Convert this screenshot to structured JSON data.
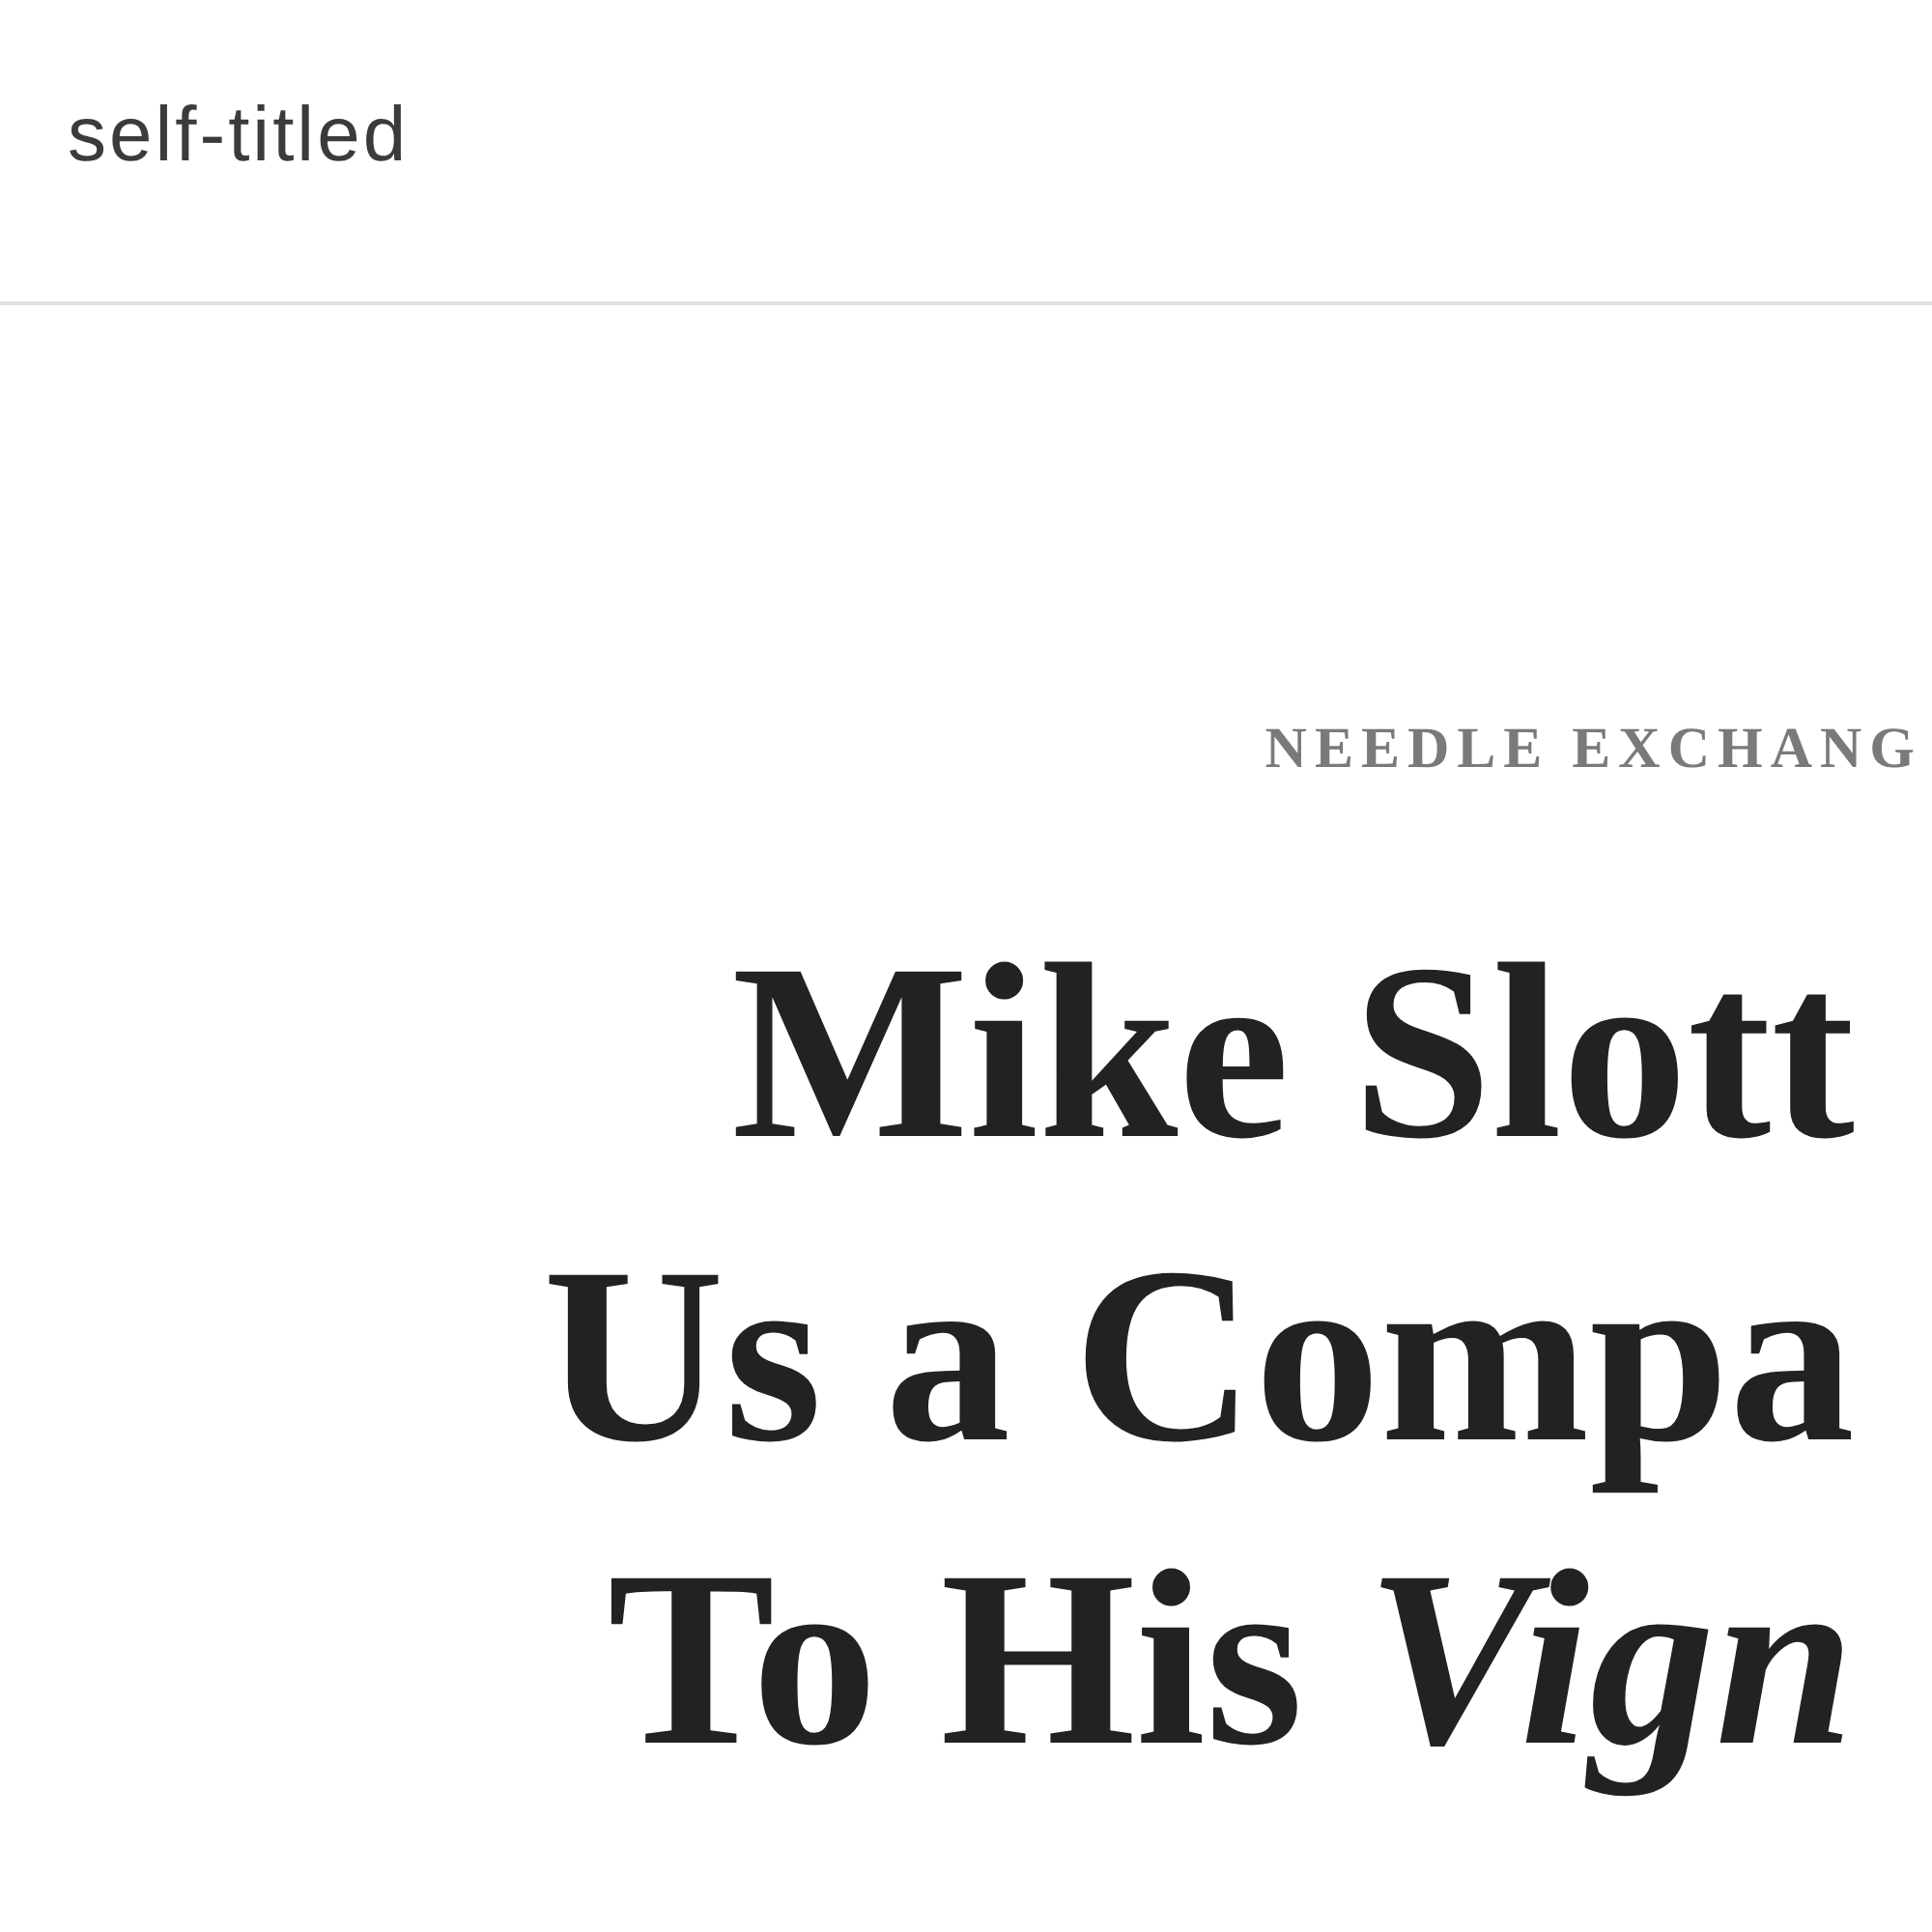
{
  "header": {
    "logo": "self-titled"
  },
  "article": {
    "category": "NEEDLE EXCHANG",
    "headline_lines": [
      "Mike Slott",
      "Us a Compa",
      "To His *Vign*"
    ]
  }
}
